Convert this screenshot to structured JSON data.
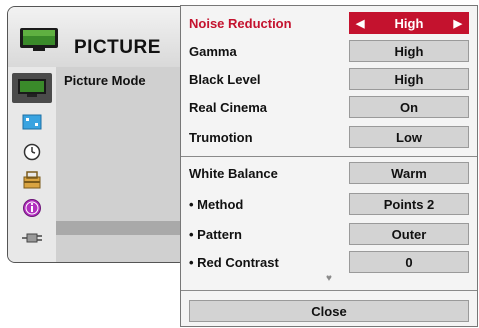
{
  "menu": {
    "title": "PICTURE",
    "picture_mode_label": "Picture Mode",
    "icons": [
      "tv-icon",
      "screen-icon",
      "clock-icon",
      "lock-icon",
      "info-icon",
      "plug-icon"
    ]
  },
  "settings": {
    "noise_reduction": {
      "label": "Noise Reduction",
      "value": "High"
    },
    "gamma": {
      "label": "Gamma",
      "value": "High"
    },
    "black_level": {
      "label": "Black Level",
      "value": "High"
    },
    "real_cinema": {
      "label": "Real Cinema",
      "value": "On"
    },
    "trumotion": {
      "label": "Trumotion",
      "value": "Low"
    },
    "white_balance": {
      "label": "White Balance",
      "value": "Warm"
    },
    "method": {
      "label": "• Method",
      "value": "Points 2"
    },
    "pattern": {
      "label": "• Pattern",
      "value": "Outer"
    },
    "red_contrast": {
      "label": "• Red Contrast",
      "value": "0"
    }
  },
  "more_indicator": "♥",
  "close_label": "Close",
  "colors": {
    "accent": "#c4122e",
    "value_box": "#d3d3d3",
    "panel": "#f4f4f4"
  }
}
